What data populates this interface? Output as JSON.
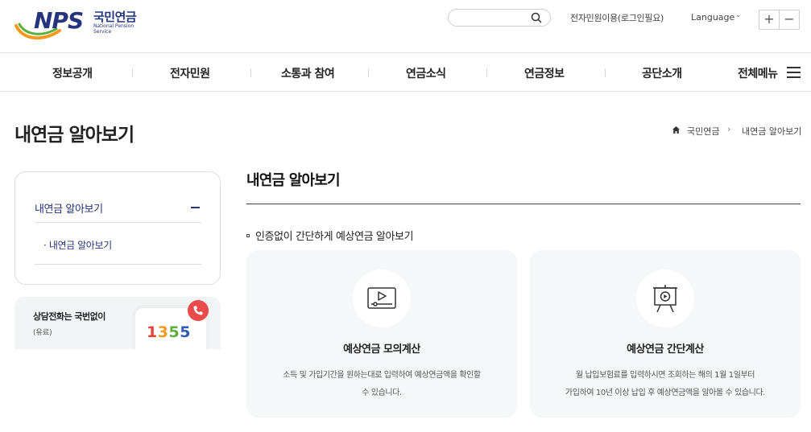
{
  "header": {
    "logo_text": "NPS",
    "logo_kr": "국민연금",
    "logo_en": "National Pension Service",
    "search_placeholder": "",
    "util_link": "전자민원이용(로그인필요)",
    "language_label": "Language",
    "zoom_in": "+",
    "zoom_out": "−"
  },
  "gnb": {
    "items": [
      "정보공개",
      "전자민원",
      "소통과 참여",
      "연금소식",
      "연금정보",
      "공단소개"
    ],
    "all_menu": "전체메뉴"
  },
  "page": {
    "title": "내연금 알아보기",
    "breadcrumb": [
      "국민연금",
      "내연금 알아보기"
    ],
    "breadcrumb_sep": "›"
  },
  "sidebar": {
    "title": "내연금 알아보기",
    "items": [
      "· 내연금 알아보기"
    ]
  },
  "phone_banner": {
    "title": "상담전화는 국번없이",
    "subtitle": "(유료)",
    "digits": [
      "1",
      "3",
      "5",
      "5"
    ]
  },
  "content": {
    "title": "내연금 알아보기",
    "section_heading": "인증없이 간단하게 예상연금 알아보기",
    "cards": [
      {
        "title": "예상연금 모의계산",
        "desc_line1": "소득 및 가입기간을 원하는대로 입력하여 예상연금액을 확인할",
        "desc_line2": "수 있습니다.",
        "icon": "video-player-icon"
      },
      {
        "title": "예상연금 간단계산",
        "desc_line1": "월 납입보험료를 입력하시면 조회하는 해의 1월 1일부터",
        "desc_line2": "가입하여 10년 이상 납입 후 예상연금액을 알아볼 수 있습니다.",
        "icon": "presentation-screen-icon"
      }
    ]
  },
  "colors": {
    "brand_navy": "#25347e",
    "logo_orange": "#f39a1e",
    "logo_green": "#5cae3c",
    "card_bg": "#f6f7f9",
    "badge_red": "#ea4b4b"
  }
}
